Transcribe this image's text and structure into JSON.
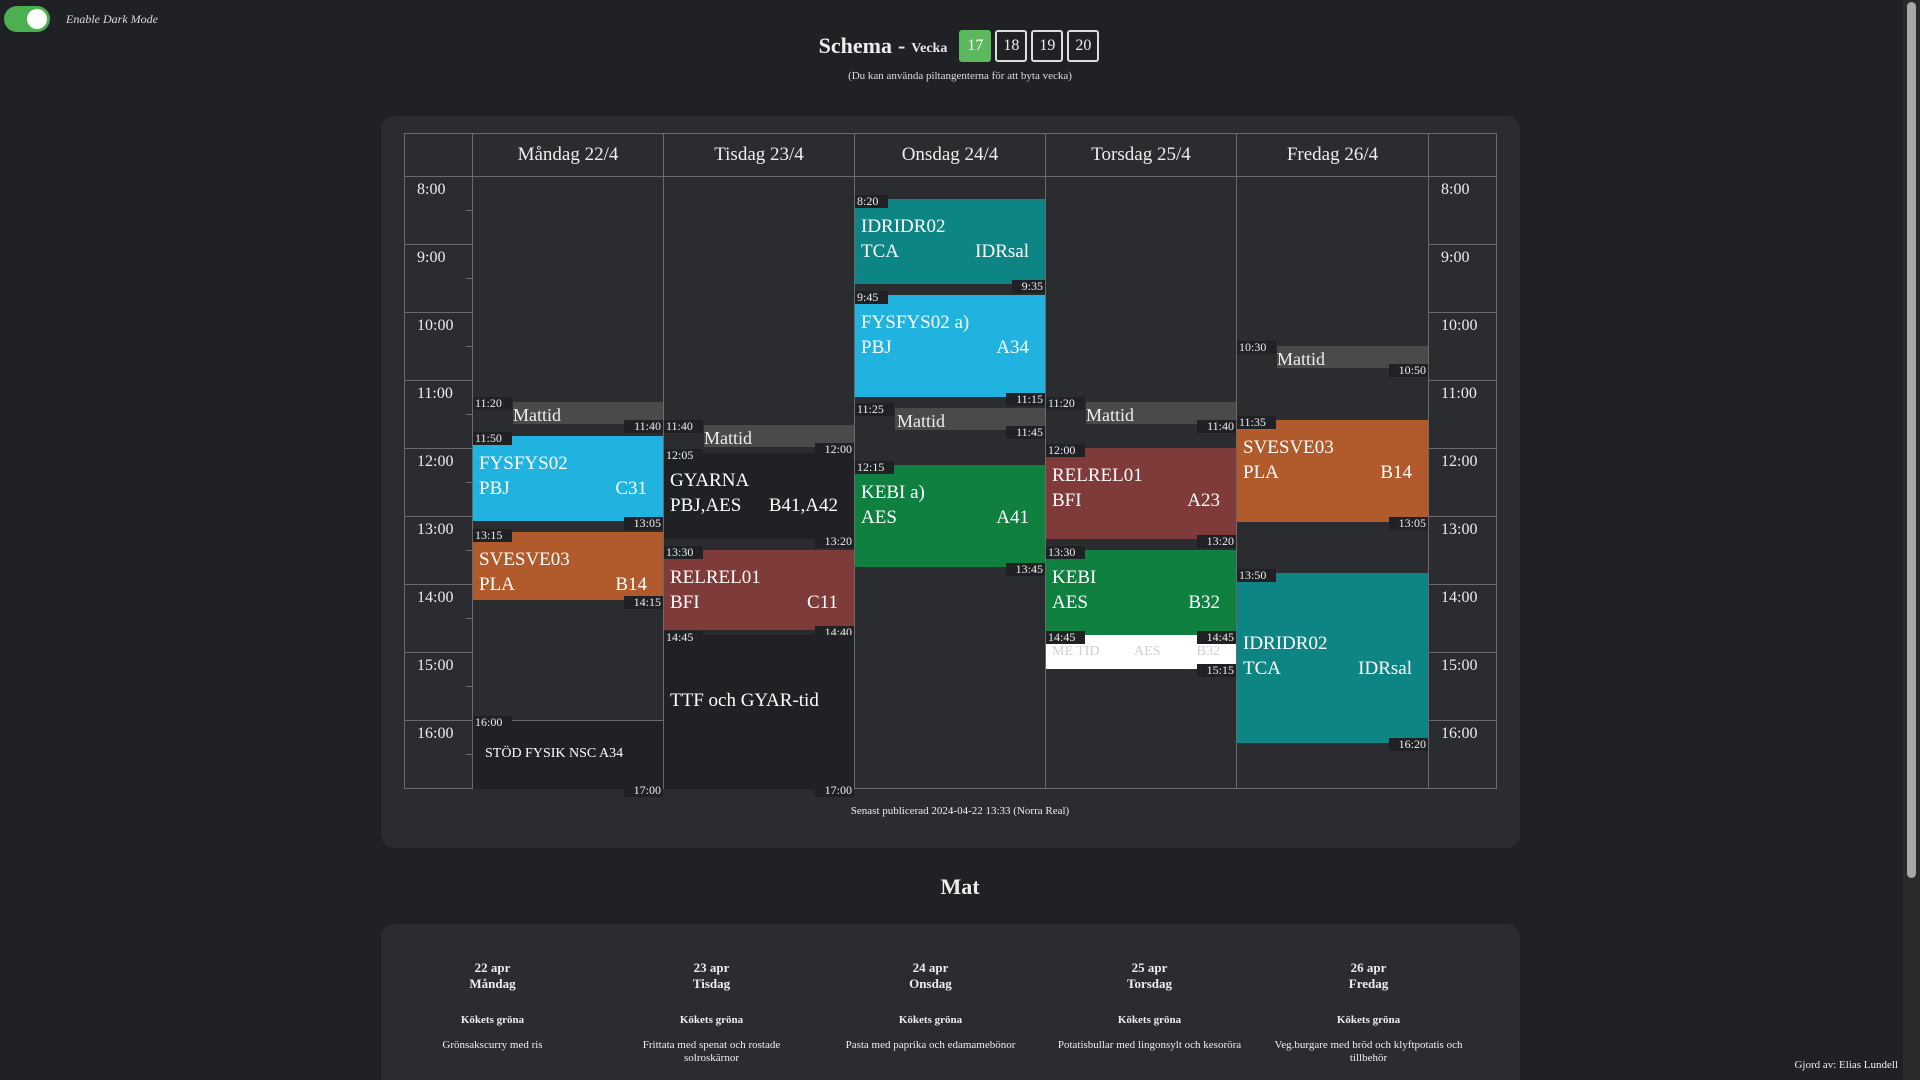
{
  "toggle": {
    "label": "Enable Dark Mode",
    "on": true
  },
  "header": {
    "title": "Schema",
    "separator": "-",
    "week_label": "Vecka",
    "weeks": [
      "17",
      "18",
      "19",
      "20"
    ],
    "active_week": "17",
    "hint": "(Du kan använda piltangenterna för att byta vecka)"
  },
  "times": [
    "8:00",
    "9:00",
    "10:00",
    "11:00",
    "12:00",
    "13:00",
    "14:00",
    "15:00",
    "16:00"
  ],
  "days": [
    {
      "name": "Måndag 22/4"
    },
    {
      "name": "Tisdag 23/4"
    },
    {
      "name": "Onsdag 24/4"
    },
    {
      "name": "Torsdag 25/4"
    },
    {
      "name": "Fredag 26/4"
    }
  ],
  "events": {
    "mon_mattid": {
      "start": "11:20",
      "end": "11:40",
      "title": "Mattid"
    },
    "mon_fys": {
      "start": "11:50",
      "end": "13:05",
      "course": "FYSFYS02",
      "teacher": "PBJ",
      "room": "C31"
    },
    "mon_sve": {
      "start": "13:15",
      "end": "14:15",
      "course": "SVESVE03",
      "teacher": "PLA",
      "room": "B14"
    },
    "mon_stod": {
      "start": "16:00",
      "end": "17:00",
      "title": "STÖD FYSIK NSC A34"
    },
    "tue_mattid": {
      "start": "11:40",
      "end": "12:00",
      "title": "Mattid"
    },
    "tue_gyarna": {
      "start": "12:05",
      "end": "13:20",
      "course": "GYARNA",
      "teacher": "PBJ,AES",
      "room": "B41,A42"
    },
    "tue_rel": {
      "start": "13:30",
      "end": "14:40",
      "course": "RELREL01",
      "teacher": "BFI",
      "room": "C11"
    },
    "tue_ttf": {
      "start": "14:45",
      "end": "17:00",
      "title": "TTF och GYAR-tid"
    },
    "wed_idr": {
      "start": "8:20",
      "end": "9:35",
      "course": "IDRIDR02",
      "teacher": "TCA",
      "room": "IDRsal"
    },
    "wed_fys": {
      "start": "9:45",
      "end": "11:15",
      "course": "FYSFYS02 a)",
      "teacher": "PBJ",
      "room": "A34"
    },
    "wed_mattid": {
      "start": "11:25",
      "end": "11:45",
      "title": "Mattid"
    },
    "wed_kebi": {
      "start": "12:15",
      "end": "13:45",
      "course": "KEBI a)",
      "teacher": "AES",
      "room": "A41"
    },
    "thu_mattid": {
      "start": "11:20",
      "end": "11:40",
      "title": "Mattid"
    },
    "thu_rel": {
      "start": "12:00",
      "end": "13:20",
      "course": "RELREL01",
      "teacher": "BFI",
      "room": "A23"
    },
    "thu_kebi": {
      "start": "13:30",
      "end": "14:45",
      "course": "KEBI",
      "teacher": "AES",
      "room": "B32"
    },
    "thu_metid": {
      "start": "14:45",
      "end": "15:15",
      "course": "ME TID",
      "teacher": "AES",
      "room": "B32"
    },
    "fri_mattid": {
      "start": "10:30",
      "end": "10:50",
      "title": "Mattid"
    },
    "fri_sve": {
      "start": "11:35",
      "end": "13:05",
      "course": "SVESVE03",
      "teacher": "PLA",
      "room": "B14"
    },
    "fri_idr": {
      "start": "13:50",
      "end": "16:20",
      "course": "IDRIDR02",
      "teacher": "TCA",
      "room": "IDRsal"
    }
  },
  "colors": {
    "physics": "#20b3e0",
    "swedish": "#b15a2c",
    "religion": "#7e3b3a",
    "chemistry": "#0f8040",
    "sports": "#0e8585",
    "dark_block": "#202124",
    "lunch": "#4a4a4a",
    "white_block": "#ffffff",
    "toggle_on": "#4caf50",
    "active_week": "#5cb85c"
  },
  "published": "Senast publicerad 2024-04-22 13:33 (Norra Real)",
  "food": {
    "title": "Mat",
    "days": [
      {
        "date": "22 apr",
        "weekday": "Måndag",
        "category": "Kökets gröna",
        "dish": "Grönsakscurry med ris"
      },
      {
        "date": "23 apr",
        "weekday": "Tisdag",
        "category": "Kökets gröna",
        "dish": "Frittata med spenat och rostade solroskärnor"
      },
      {
        "date": "24 apr",
        "weekday": "Onsdag",
        "category": "Kökets gröna",
        "dish": "Pasta med paprika och edamamebönor"
      },
      {
        "date": "25 apr",
        "weekday": "Torsdag",
        "category": "Kökets gröna",
        "dish": "Potatisbullar med lingonsylt och kesoröra"
      },
      {
        "date": "26 apr",
        "weekday": "Fredag",
        "category": "Kökets gröna",
        "dish": "Veg.burgare med bröd och klyftpotatis och tillbehör"
      }
    ]
  },
  "credits": "Gjord av: Elias Lundell"
}
